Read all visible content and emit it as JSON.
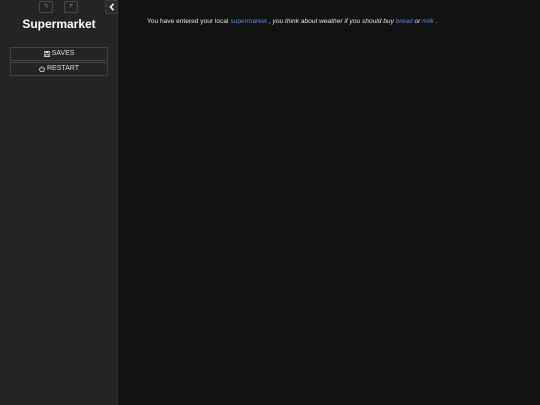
{
  "sidebar": {
    "title": "Supermarket",
    "undo_label": "↰",
    "redo_label": "↱",
    "menu": [
      {
        "label": "SAVES",
        "icon": "floppy-disk-icon"
      },
      {
        "label": "RESTART",
        "icon": "power-icon"
      }
    ],
    "collapse_icon": "chevron-left-icon"
  },
  "passage": {
    "text_1": "You have entered your local",
    "link_supermarket": "supermarket",
    "text_2": ",",
    "italic_1": "you think about weather if you should buy",
    "link_bread": "bread",
    "italic_or": "or",
    "link_milk": "milk",
    "text_end": "."
  },
  "colors": {
    "sidebar_bg": "#242424",
    "main_bg": "#121212",
    "link": "#5b8fd8"
  }
}
